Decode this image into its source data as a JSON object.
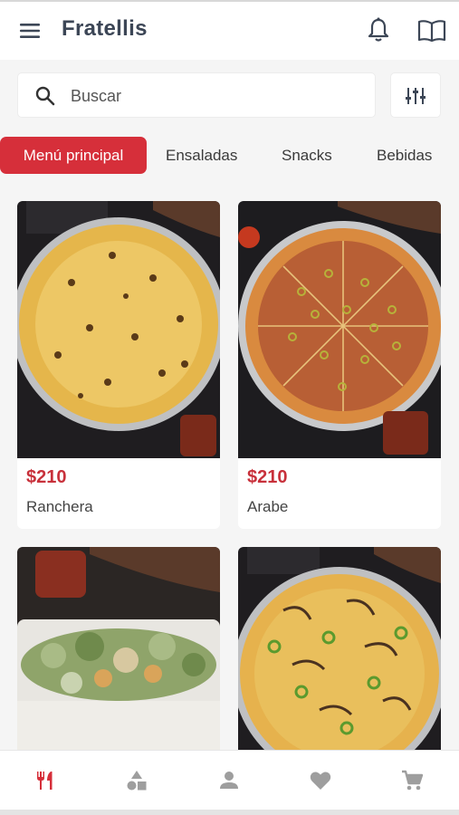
{
  "app": {
    "title": "Fratellis"
  },
  "icons": {
    "menu": "menu-icon",
    "notifications": "bell-icon",
    "menu_book": "book-icon",
    "search": "search-icon",
    "filter": "filter-sliders-icon"
  },
  "search": {
    "placeholder": "Buscar",
    "value": ""
  },
  "tabs": [
    {
      "label": "Menú principal",
      "active": true
    },
    {
      "label": "Ensaladas",
      "active": false
    },
    {
      "label": "Snacks",
      "active": false
    },
    {
      "label": "Bebidas",
      "active": false
    }
  ],
  "products": [
    {
      "price": "$210",
      "name": "Ranchera",
      "image": "cheese-pizza"
    },
    {
      "price": "$210",
      "name": "Arabe",
      "image": "olive-pizza"
    },
    {
      "price": "",
      "name": "",
      "image": "caesar-salad"
    },
    {
      "price": "",
      "name": "",
      "image": "jalapeno-pizza"
    }
  ],
  "bottom_nav": [
    {
      "icon": "fork-knife-icon",
      "active": true
    },
    {
      "icon": "categories-icon",
      "active": false
    },
    {
      "icon": "person-icon",
      "active": false
    },
    {
      "icon": "heart-icon",
      "active": false
    },
    {
      "icon": "cart-icon",
      "active": false
    }
  ],
  "colors": {
    "accent": "#d62f3a",
    "price": "#c8313b",
    "title": "#3c4656",
    "nav_inactive": "#9e9e9e"
  }
}
